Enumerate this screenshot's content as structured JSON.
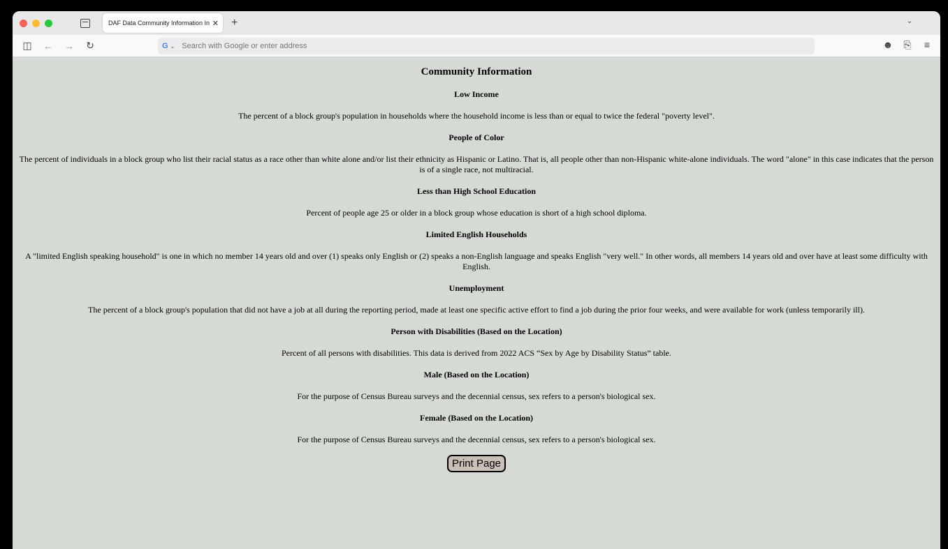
{
  "browser": {
    "tab_title": "DAF Data Community Information In",
    "tab_close": "✕",
    "new_tab": "+",
    "address_placeholder": "Search with Google or enter address",
    "search_engine": "G",
    "icons": [
      "sidebar-icon",
      "back-icon",
      "forward-icon",
      "reload-icon",
      "account-icon",
      "extensions-icon",
      "menu-icon"
    ]
  },
  "page": {
    "title": "Community Information",
    "sections": [
      {
        "heading": "Low Income",
        "text": "The percent of a block group's population in households where the household income is less than or equal to twice the federal \"poverty level\"."
      },
      {
        "heading": "People of Color",
        "text": "The percent of individuals in a block group who list their racial status as a race other than white alone and/or list their ethnicity as Hispanic or Latino. That is, all people other than non-Hispanic white-alone individuals. The word \"alone\" in this case indicates that the person is of a single race, not multiracial."
      },
      {
        "heading": "Less than High School Education",
        "text": "Percent of people age 25 or older in a block group whose education is short of a high school diploma."
      },
      {
        "heading": "Limited English Households",
        "text": "A \"limited English speaking household\" is one in which no member 14 years old and over (1) speaks only English or (2) speaks a non-English language and speaks English \"very well.\" In other words, all members 14 years old and over have at least some difficulty with English."
      },
      {
        "heading": "Unemployment",
        "text": "The percent of a block group's population that did not have a job at all during the reporting period, made at least one specific active effort to find a job during the prior four weeks, and were available for work (unless temporarily ill)."
      },
      {
        "heading": "Person with Disabilities (Based on the Location)",
        "text": "Percent of all persons with disabilities. This data is derived from 2022 ACS “Sex by Age by Disability Status” table."
      },
      {
        "heading": "Male (Based on the Location)",
        "text": "For the purpose of Census Bureau surveys and the decennial census, sex refers to a person's biological sex."
      },
      {
        "heading": "Female (Based on the Location)",
        "text": "For the purpose of Census Bureau surveys and the decennial census, sex refers to a person's biological sex."
      }
    ],
    "print_button": "Print Page"
  }
}
